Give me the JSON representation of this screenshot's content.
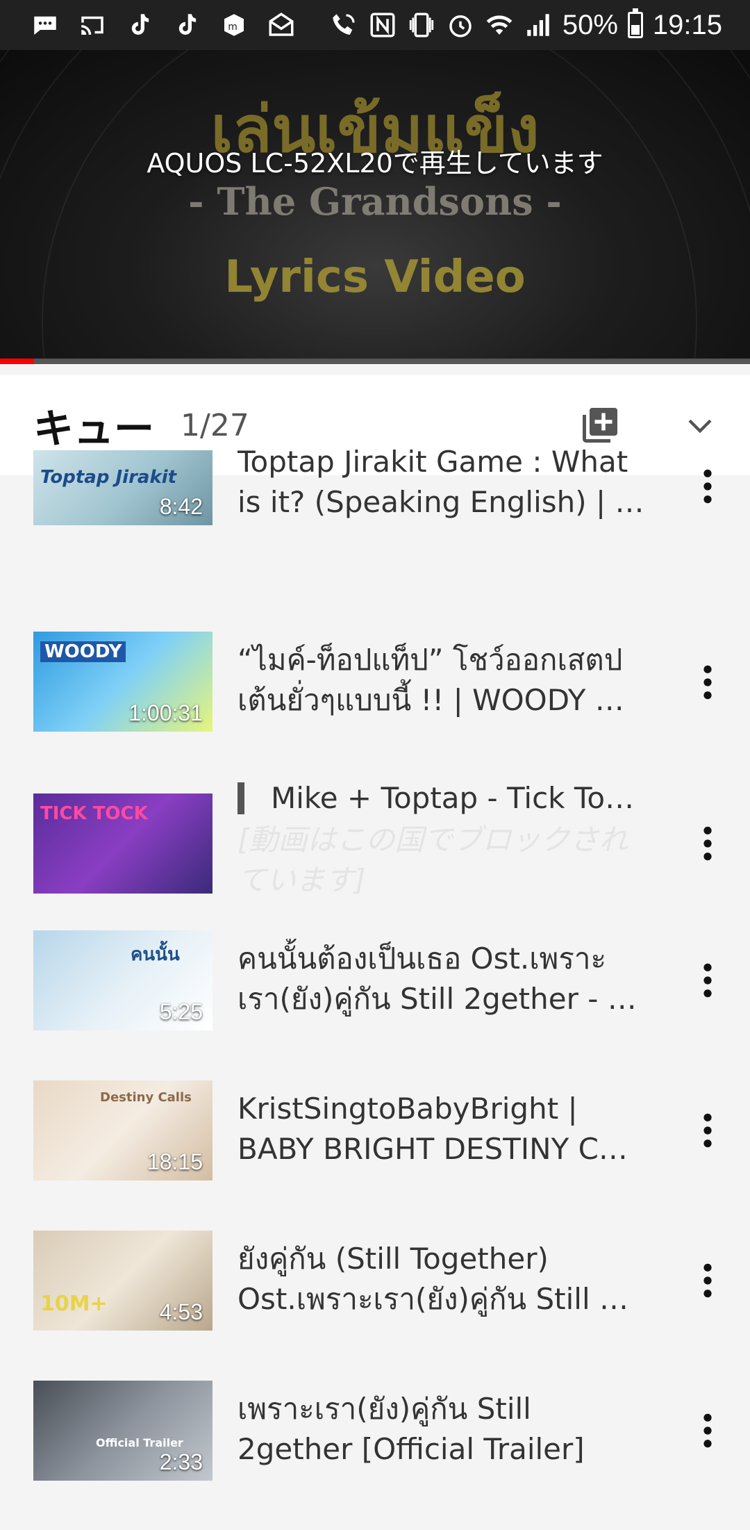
{
  "status_bar": {
    "battery_percent": "50%",
    "time": "19:15",
    "left_icons": [
      "message-icon",
      "cast-icon",
      "tiktok-icon",
      "tiktok-icon",
      "app-icon",
      "mail-icon"
    ],
    "right_icons": [
      "wifi-calling-icon",
      "nfc-icon",
      "vibrate-icon",
      "alarm-icon",
      "wifi-icon",
      "signal-icon"
    ]
  },
  "player": {
    "artwork_title_line1": "เล่นเข้มแข็ง",
    "artwork_title_line2": "- The Grandsons -",
    "artwork_title_line3": "Lyrics Video",
    "cast_status": "AQUOS LC-52XL20で再生しています",
    "progress_fraction": 0.045,
    "progress_color": "#ff0000"
  },
  "queue": {
    "title": "キュー",
    "position": "1/27"
  },
  "items": [
    {
      "title": "Toptap Jirakit Game : What is it? (Speaking English) | …",
      "duration": "8:42",
      "caption": "Toptap Jirakit"
    },
    {
      "title": "“ไมค์-ท็อปแท็ป” โชว์ออกเสตปเต้นยั่วๆแบบนี้ !! | WOODY …",
      "duration": "1:00:31",
      "caption": "WOODY"
    },
    {
      "title": "Mike + Toptap - Tick To…",
      "note": "[動画はこの国でブロックされています]",
      "caption": "TICK TOCK",
      "playing": true
    },
    {
      "title": "คนนั้นต้องเป็นเธอ Ost.เพราะเรา(ยัง)คู่กัน Still 2gether - …",
      "duration": "5:25",
      "caption": "คนนั้น"
    },
    {
      "title": "KristSingtoBabyBright | BABY BRIGHT DESTINY C…",
      "duration": "18:15",
      "caption": "Destiny Calls"
    },
    {
      "title": "ยังคู่กัน (Still Together) Ost.เพราะเรา(ยัง)คู่กัน Still …",
      "duration": "4:53",
      "caption": "10M+"
    },
    {
      "title": "เพราะเรา(ยัง)คู่กัน Still 2gether [Official Trailer]",
      "duration": "2:33",
      "caption": "Official Trailer"
    }
  ]
}
